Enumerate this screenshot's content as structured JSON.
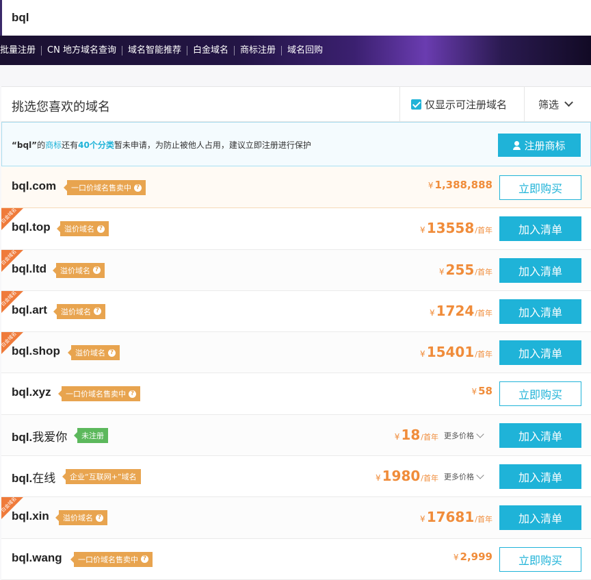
{
  "search": {
    "value": "bql"
  },
  "nav": {
    "links": [
      "批量注册",
      "CN 地方域名查询",
      "域名智能推荐",
      "白金域名",
      "商标注册",
      "域名回购"
    ]
  },
  "panel": {
    "title": "挑选您喜欢的域名",
    "only_available_label": "仅显示可注册域名",
    "only_available_checked": true,
    "filter_label": "筛选"
  },
  "trademark_notice": {
    "quote": "“bql”",
    "part1": "的",
    "link": "商标",
    "part2": "还有",
    "categories": "40个分类",
    "part3": "暂未申请，为防止被他人占用，建议立即注册进行保护",
    "button_label": "注册商标"
  },
  "ribbon_label": "白金域名",
  "rows": [
    {
      "domain": "bql.com",
      "tag": "一口价域名售卖中",
      "tag_help": "?",
      "price_yen": "¥",
      "price": "1,388,888",
      "unit": "",
      "more": "",
      "button": "立即购买"
    },
    {
      "domain": "bql.top",
      "tag": "溢价域名",
      "tag_help": "?",
      "price_yen": "¥",
      "price": "13558",
      "unit": "/首年",
      "more": "",
      "button": "加入清单"
    },
    {
      "domain": "bql.ltd",
      "tag": "溢价域名",
      "tag_help": "?",
      "price_yen": "¥",
      "price": "255",
      "unit": "/首年",
      "more": "",
      "button": "加入清单"
    },
    {
      "domain": "bql.art",
      "tag": "溢价域名",
      "tag_help": "?",
      "price_yen": "¥",
      "price": "1724",
      "unit": "/首年",
      "more": "",
      "button": "加入清单"
    },
    {
      "domain": "bql.shop",
      "tag": "溢价域名",
      "tag_help": "?",
      "price_yen": "¥",
      "price": "15401",
      "unit": "/首年",
      "more": "",
      "button": "加入清单"
    },
    {
      "domain": "bql.xyz",
      "tag": "一口价域名售卖中",
      "tag_help": "?",
      "price_yen": "¥",
      "price": "58",
      "unit": "",
      "more": "",
      "button": "立即购买"
    },
    {
      "domain_ascii": "bql.",
      "domain_cn": "我爱你",
      "tag": "未注册",
      "tag_help": "",
      "price_yen": "¥",
      "price": "18",
      "unit": "/首年",
      "more": "更多价格",
      "button": "加入清单"
    },
    {
      "domain_ascii": "bql.",
      "domain_cn": "在线",
      "tag": "企业“互联网+”域名",
      "tag_help": "",
      "price_yen": "¥",
      "price": "1980",
      "unit": "/首年",
      "more": "更多价格",
      "button": "加入清单"
    },
    {
      "domain": "bql.xin",
      "tag": "溢价域名",
      "tag_help": "?",
      "price_yen": "¥",
      "price": "17681",
      "unit": "/首年",
      "more": "",
      "button": "加入清单"
    },
    {
      "domain": "bql.wang",
      "tag": "一口价域名售卖中",
      "tag_help": "?",
      "price_yen": "¥",
      "price": "2,999",
      "unit": "",
      "more": "",
      "button": "立即购买"
    }
  ],
  "colors": {
    "accent": "#1fb3d8",
    "price": "#f08c3a",
    "tag_orange": "#e8a44f",
    "tag_green": "#5cb85c",
    "ribbon": "#ef7b3b"
  }
}
